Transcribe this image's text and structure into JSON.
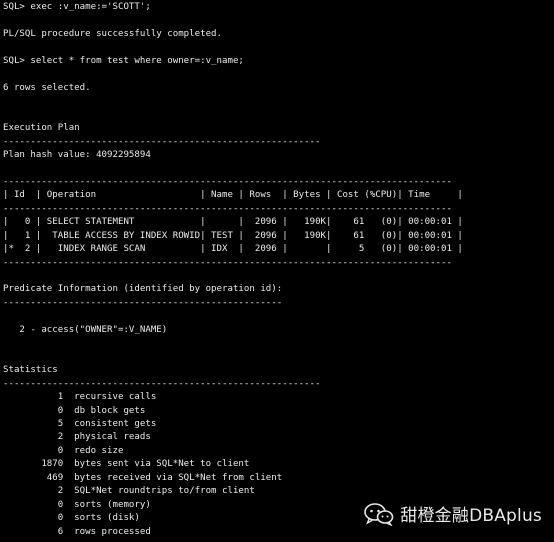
{
  "terminal": {
    "lines": [
      "SQL> exec :v_name:='SCOTT';",
      "",
      "PL/SQL procedure successfully completed.",
      "",
      "SQL> select * from test where owner=:v_name;",
      "",
      "6 rows selected.",
      "",
      "",
      "Execution Plan",
      "----------------------------------------------------------",
      "Plan hash value: 4092295894",
      "",
      "----------------------------------------------------------------------------------",
      "| Id  | Operation                   | Name | Rows  | Bytes | Cost (%CPU)| Time     |",
      "----------------------------------------------------------------------------------",
      "|   0 | SELECT STATEMENT            |      |  2096 |   190K|    61   (0)| 00:00:01 |",
      "|   1 |  TABLE ACCESS BY INDEX ROWID| TEST |  2096 |   190K|    61   (0)| 00:00:01 |",
      "|*  2 |   INDEX RANGE SCAN          | IDX  |  2096 |       |     5   (0)| 00:00:01 |",
      "----------------------------------------------------------------------------------",
      "",
      "Predicate Information (identified by operation id):",
      "---------------------------------------------------",
      "",
      "   2 - access(\"OWNER\"=:V_NAME)",
      "",
      "",
      "Statistics",
      "----------------------------------------------------------",
      "          1  recursive calls",
      "          0  db block gets",
      "          5  consistent gets",
      "          2  physical reads",
      "          0  redo size",
      "       1870  bytes sent via SQL*Net to client",
      "        469  bytes received via SQL*Net from client",
      "          2  SQL*Net roundtrips to/from client",
      "          0  sorts (memory)",
      "          0  sorts (disk)",
      "          6  rows processed"
    ]
  },
  "watermark": {
    "text": "甜橙金融DBAplus",
    "icon": "wechat-icon"
  },
  "colors": {
    "background": "#000000",
    "text": "#ececec"
  }
}
